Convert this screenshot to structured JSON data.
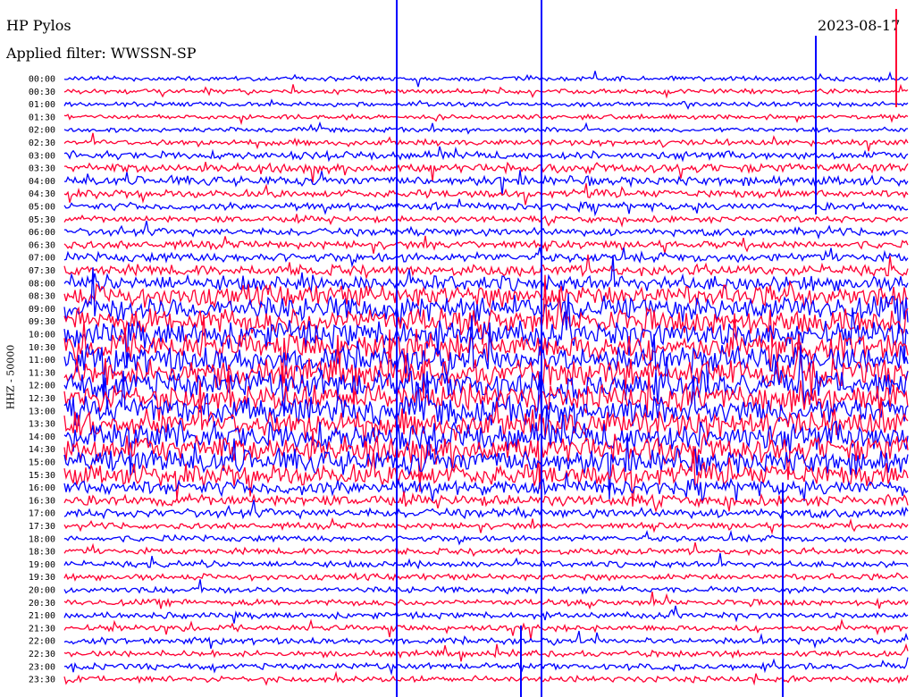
{
  "header": {
    "title": "HP Pylos",
    "date": "2023-08-17",
    "filter": "Applied filter: WWSSN-SP"
  },
  "chart_data": {
    "type": "line",
    "chart_kind": "helicorder",
    "ylabel": "HHZ - 50000",
    "trace_colors": [
      "#0000ff",
      "#ff0033"
    ],
    "background": "#ffffff",
    "row_labels": [
      "00:00",
      "00:30",
      "01:00",
      "01:30",
      "02:00",
      "02:30",
      "03:00",
      "03:30",
      "04:00",
      "04:30",
      "05:00",
      "05:30",
      "06:00",
      "06:30",
      "07:00",
      "07:30",
      "08:00",
      "08:30",
      "09:00",
      "09:30",
      "10:00",
      "10:30",
      "11:00",
      "11:30",
      "12:00",
      "12:30",
      "13:00",
      "13:30",
      "14:00",
      "14:30",
      "15:00",
      "15:30",
      "16:00",
      "16:30",
      "17:00",
      "17:30",
      "18:00",
      "18:30",
      "19:00",
      "19:30",
      "20:00",
      "20:30",
      "21:00",
      "21:30",
      "22:00",
      "22:30",
      "23:00",
      "23:30"
    ],
    "row_amplitude": [
      3,
      3,
      3,
      3,
      3,
      4,
      5,
      6,
      6,
      5,
      5,
      4,
      5,
      5,
      6,
      7,
      10,
      14,
      16,
      17,
      17,
      18,
      18,
      18,
      18,
      18,
      18,
      18,
      18,
      18,
      16,
      14,
      10,
      7,
      6,
      4,
      4,
      4,
      4,
      4,
      4,
      4,
      4,
      4,
      4,
      4,
      4,
      4
    ],
    "grid": false,
    "legend": "none"
  }
}
